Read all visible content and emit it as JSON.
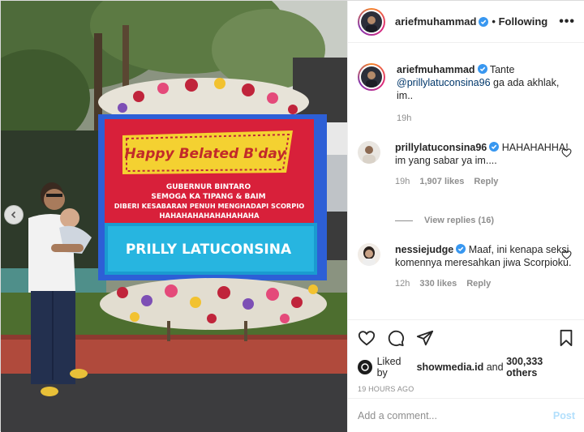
{
  "header": {
    "username": "ariefmuhammad",
    "follow_state": "• Following",
    "more_icon": "ellipsis-icon"
  },
  "caption": {
    "username": "ariefmuhammad",
    "text_prefix": "Tante",
    "mention": "@prillylatuconsina96",
    "text_suffix": "ga ada akhlak, im..",
    "time": "19h"
  },
  "comments": [
    {
      "username": "prillylatuconsina96",
      "text": "HAHAHAHHA! im yang sabar ya im....",
      "time": "19h",
      "likes": "1,907 likes",
      "reply_label": "Reply",
      "view_replies": "View replies (16)"
    },
    {
      "username": "nessiejudge",
      "text": "Maaf, ini kenapa seksi komennya meresahkan jiwa Scorpioku.",
      "time": "12h",
      "likes": "330 likes",
      "reply_label": "Reply"
    }
  ],
  "liked_by": {
    "prefix": "Liked by",
    "user": "showmedia.id",
    "middle": "and",
    "others": "300,333 others"
  },
  "timestamp": "19 HOURS AGO",
  "comment_box": {
    "placeholder": "Add a comment...",
    "post_label": "Post"
  },
  "photo": {
    "banner_line1": "Happy Belated B'day",
    "banner_line2": "GUBERNUR BINTARO",
    "banner_line3": "SEMOGA KA TIPANG & BAIM",
    "banner_line4": "DIBERI KESABARAN PENUH MENGHADAPI SCORPIO",
    "banner_line5": "HAHAHAHAHAHAHAHAHA",
    "banner_name": "PRILLY LATUCONSINA"
  },
  "colors": {
    "link": "#00376b",
    "muted": "#8e8e8e",
    "post_disabled": "#b2dffc",
    "verified": "#3897f0"
  }
}
